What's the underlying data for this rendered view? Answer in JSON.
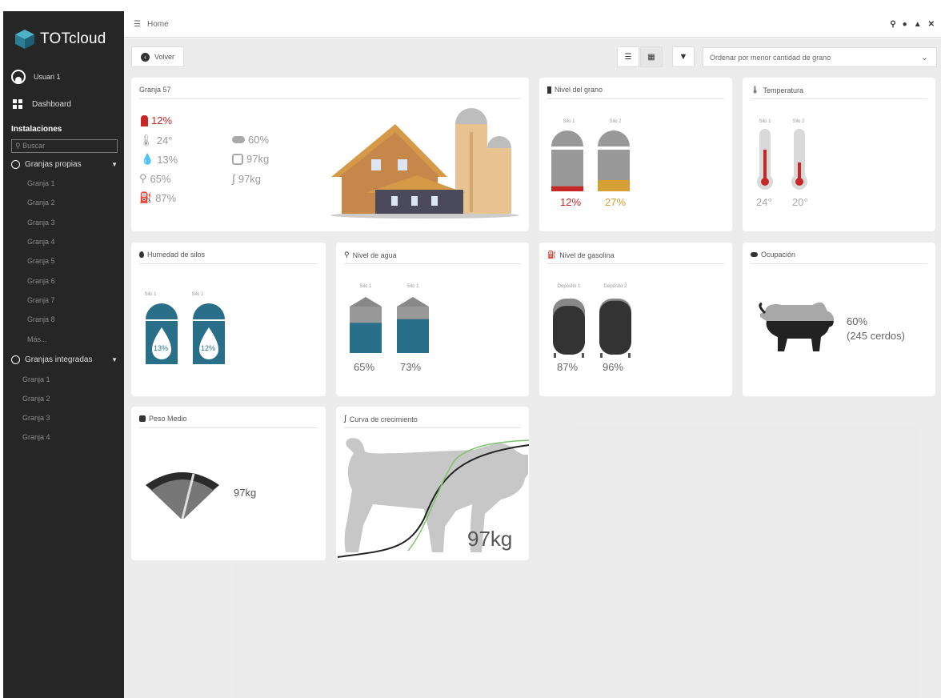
{
  "app": {
    "logo_text": "TOTcloud"
  },
  "sidebar": {
    "user": "Usuari 1",
    "dashboard": "Dashboard",
    "section": "Instalaciones",
    "search_placeholder": "Buscar",
    "groups": [
      {
        "label": "Granjas propias",
        "items": [
          "Granja 1",
          "Granja 2",
          "Granja 3",
          "Granja 4",
          "Granja 5",
          "Granja 6",
          "Granja 7",
          "Granja 8",
          "Más..."
        ]
      },
      {
        "label": "Granjas integradas",
        "items": [
          "Granja 1",
          "Granja 2",
          "Granja 3",
          "Granja 4"
        ]
      }
    ]
  },
  "topbar": {
    "breadcrumb": "Home",
    "icons": [
      "search-icon",
      "user-icon",
      "alert-icon",
      "expand-icon"
    ]
  },
  "toolbar": {
    "back": "Volver",
    "sort_select": "Ordenar por menor cantidad de grano"
  },
  "farm_card": {
    "title": "Granja 57",
    "grain": "12%",
    "temp": "24°",
    "humidity": "13%",
    "water": "65%",
    "fuel": "87%",
    "occupancy": "60%",
    "weight": "97kg",
    "growth": "97kg"
  },
  "grain_card": {
    "title": "Nivel del grano",
    "silos": [
      {
        "label": "Silo 1",
        "value": "12%",
        "level": 0.12,
        "color": "#c62828"
      },
      {
        "label": "Silo 2",
        "value": "27%",
        "level": 0.27,
        "color": "#d4a035"
      }
    ]
  },
  "temp_card": {
    "title": "Temperatura",
    "silos": [
      {
        "label": "Silo 1",
        "value": "24°"
      },
      {
        "label": "Silo 2",
        "value": "20°"
      }
    ]
  },
  "humidity_card": {
    "title": "Humedad de silos",
    "silos": [
      {
        "label": "Silo 1",
        "value": "13%"
      },
      {
        "label": "Silo 2",
        "value": "12%"
      }
    ]
  },
  "water_card": {
    "title": "Nivel de agua",
    "silos": [
      {
        "label": "Silo 1",
        "value": "65%",
        "level": 0.65
      },
      {
        "label": "Silo 1",
        "value": "73%",
        "level": 0.73
      }
    ]
  },
  "fuel_card": {
    "title": "Nivel de gasolina",
    "tanks": [
      {
        "label": "Depósito 1",
        "value": "87%",
        "level": 0.87
      },
      {
        "label": "Depósito 2",
        "value": "96%",
        "level": 0.96
      }
    ]
  },
  "occupancy_card": {
    "title": "Ocupación",
    "value": "60%",
    "detail": "(245 cerdos)",
    "level": 0.6
  },
  "weight_card": {
    "title": "Peso Medio",
    "value": "97kg"
  },
  "growth_card": {
    "title": "Curva de crecimiento",
    "value": "97kg"
  },
  "colors": {
    "sidebar": "#262626",
    "accent_red": "#c62828",
    "accent_gold": "#d4a035",
    "water": "#2a6f8a",
    "fuel": "#333333"
  }
}
